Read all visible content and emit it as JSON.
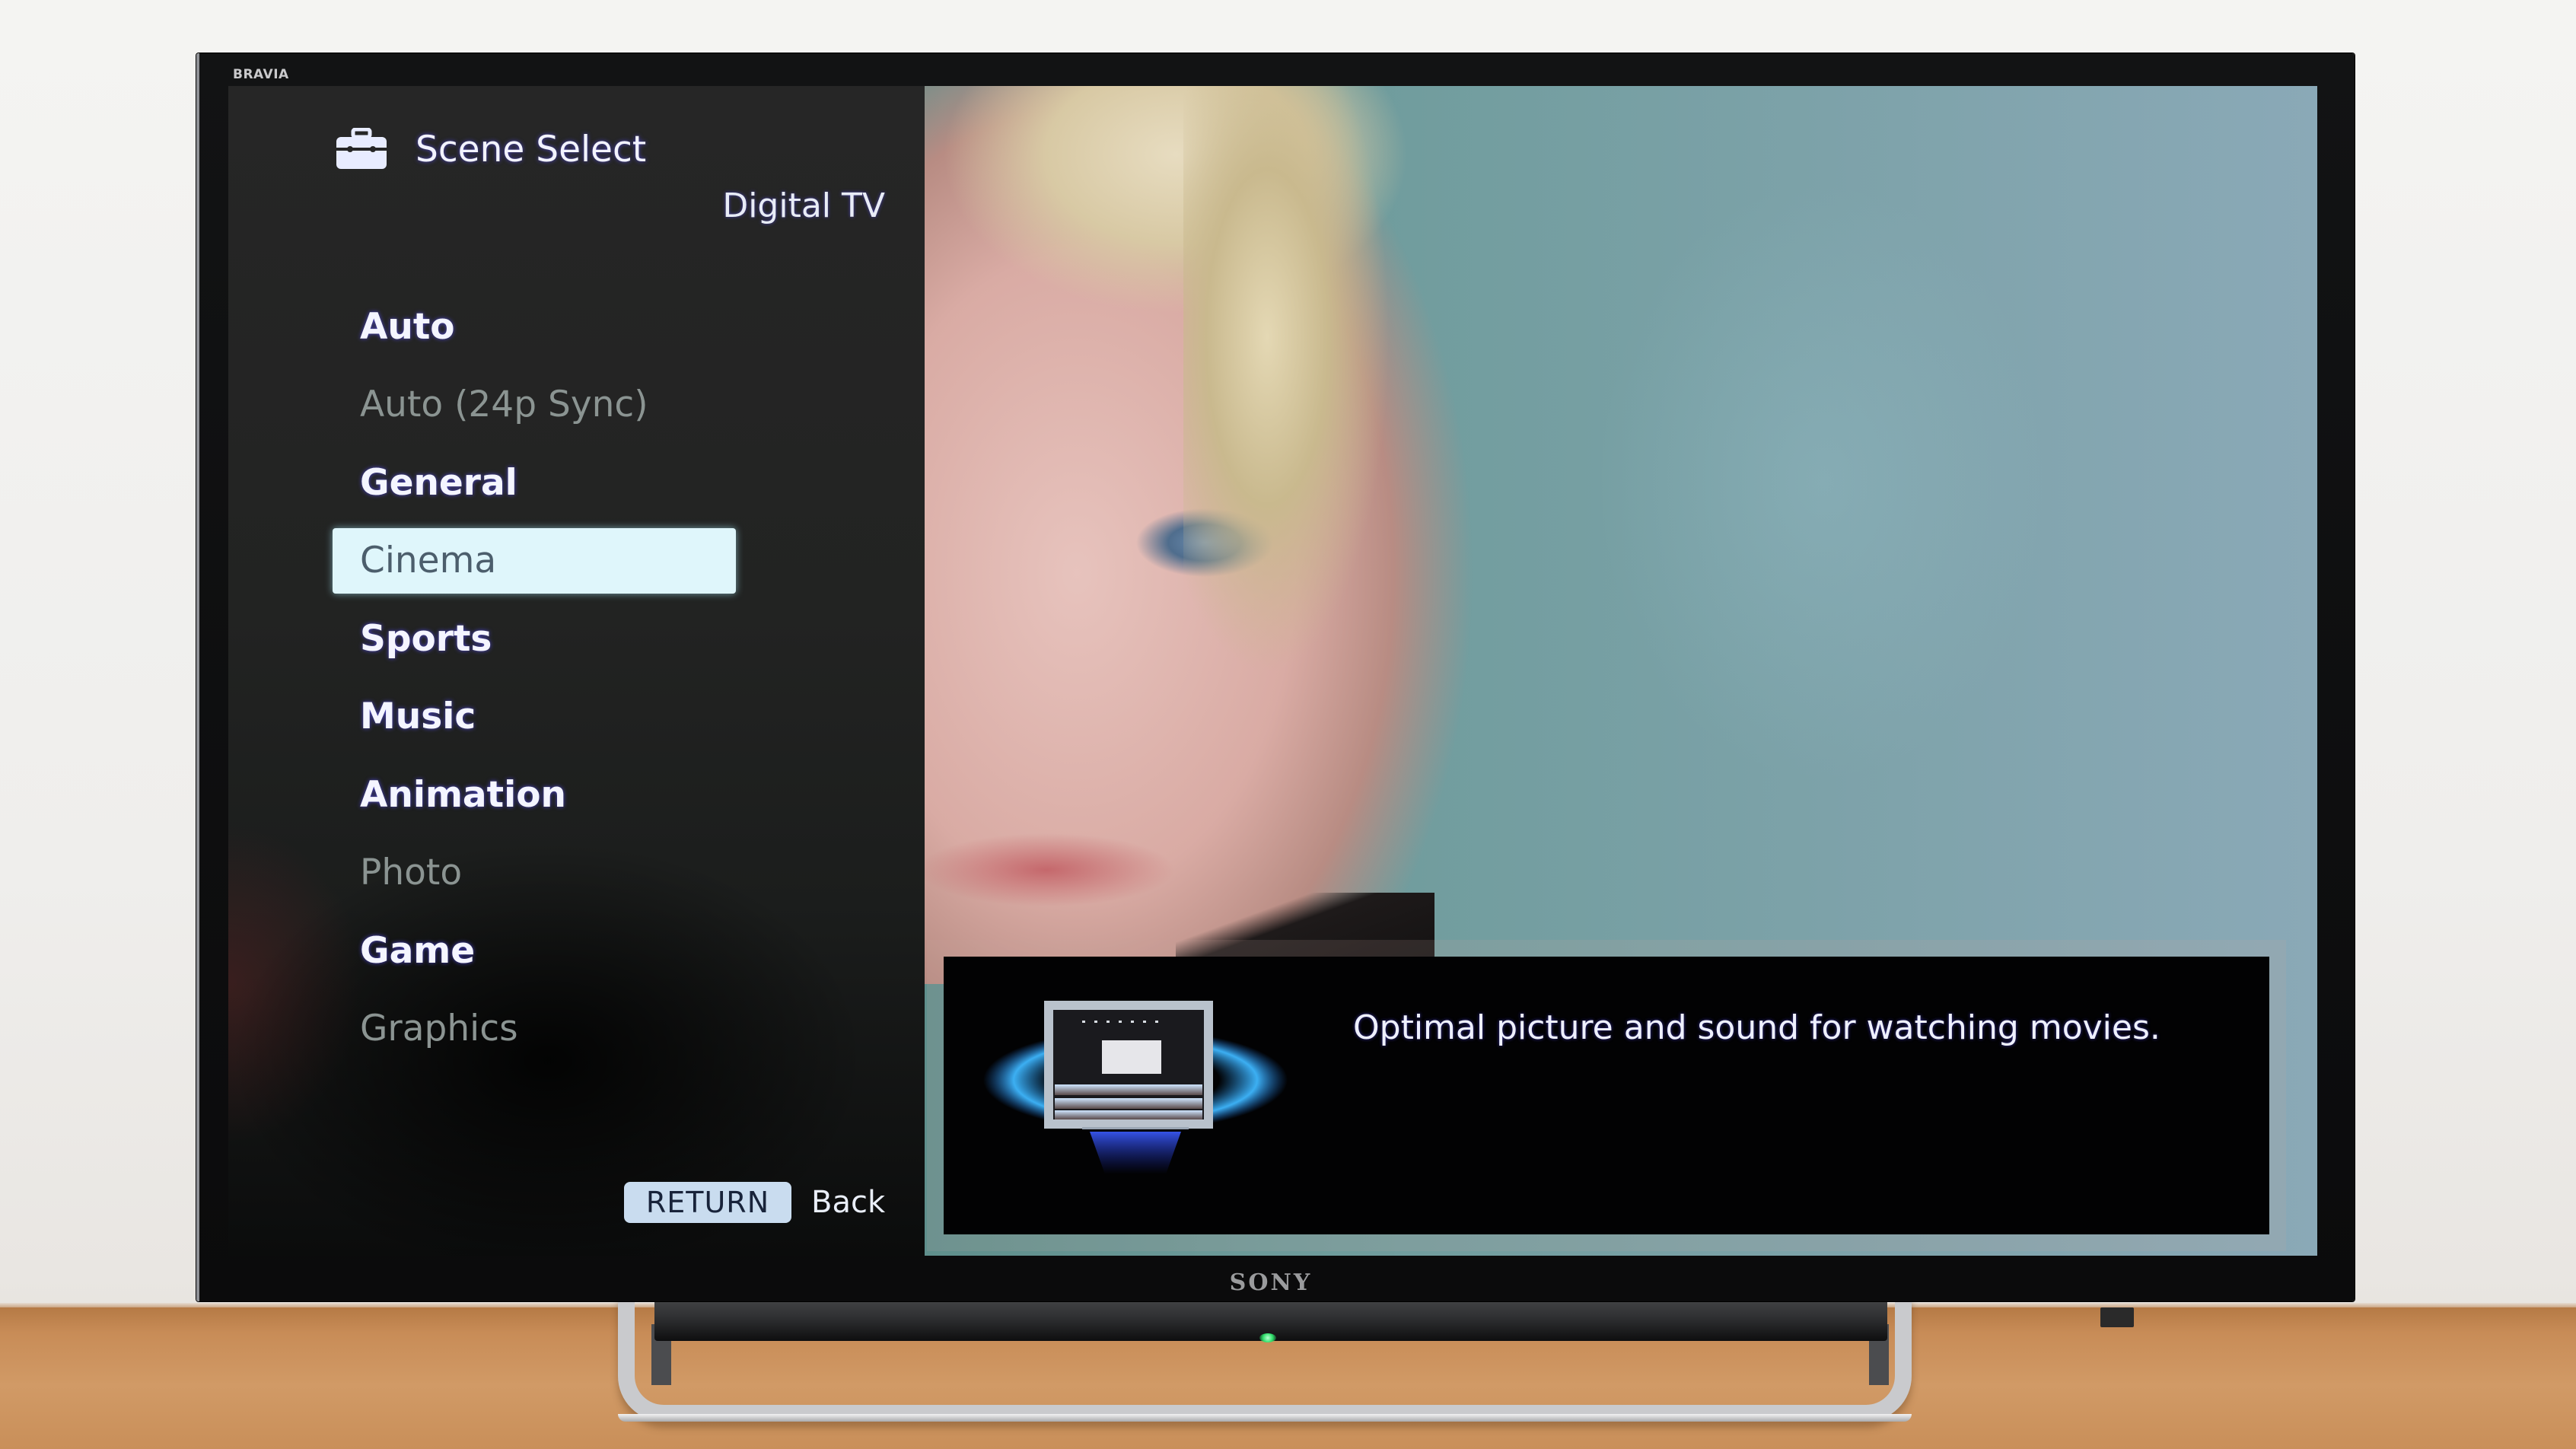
{
  "device": {
    "brand_badge": "BRAVIA",
    "manufacturer_logo": "SONY",
    "power_led_color": "#2ee06a"
  },
  "menu": {
    "icon": "toolbox-icon",
    "title": "Scene Select",
    "source": "Digital TV",
    "selected_index": 3,
    "items": [
      {
        "label": "Auto",
        "state": "enabled"
      },
      {
        "label": "Auto (24p Sync)",
        "state": "disabled"
      },
      {
        "label": "General",
        "state": "enabled"
      },
      {
        "label": "Cinema",
        "state": "selected"
      },
      {
        "label": "Sports",
        "state": "enabled"
      },
      {
        "label": "Music",
        "state": "enabled"
      },
      {
        "label": "Animation",
        "state": "enabled"
      },
      {
        "label": "Photo",
        "state": "disabled"
      },
      {
        "label": "Game",
        "state": "enabled"
      },
      {
        "label": "Graphics",
        "state": "disabled"
      }
    ],
    "footer": {
      "key_label": "RETURN",
      "action_label": "Back"
    }
  },
  "info": {
    "icon": "cinema-icon",
    "description": "Optimal picture and sound for watching movies."
  },
  "colors": {
    "highlight_bg": "#dff6fb",
    "highlight_text": "#4c5e6c",
    "enabled_text": "#f4f5ff",
    "disabled_text": "#8b9492",
    "return_key_bg": "#c9dcef"
  }
}
